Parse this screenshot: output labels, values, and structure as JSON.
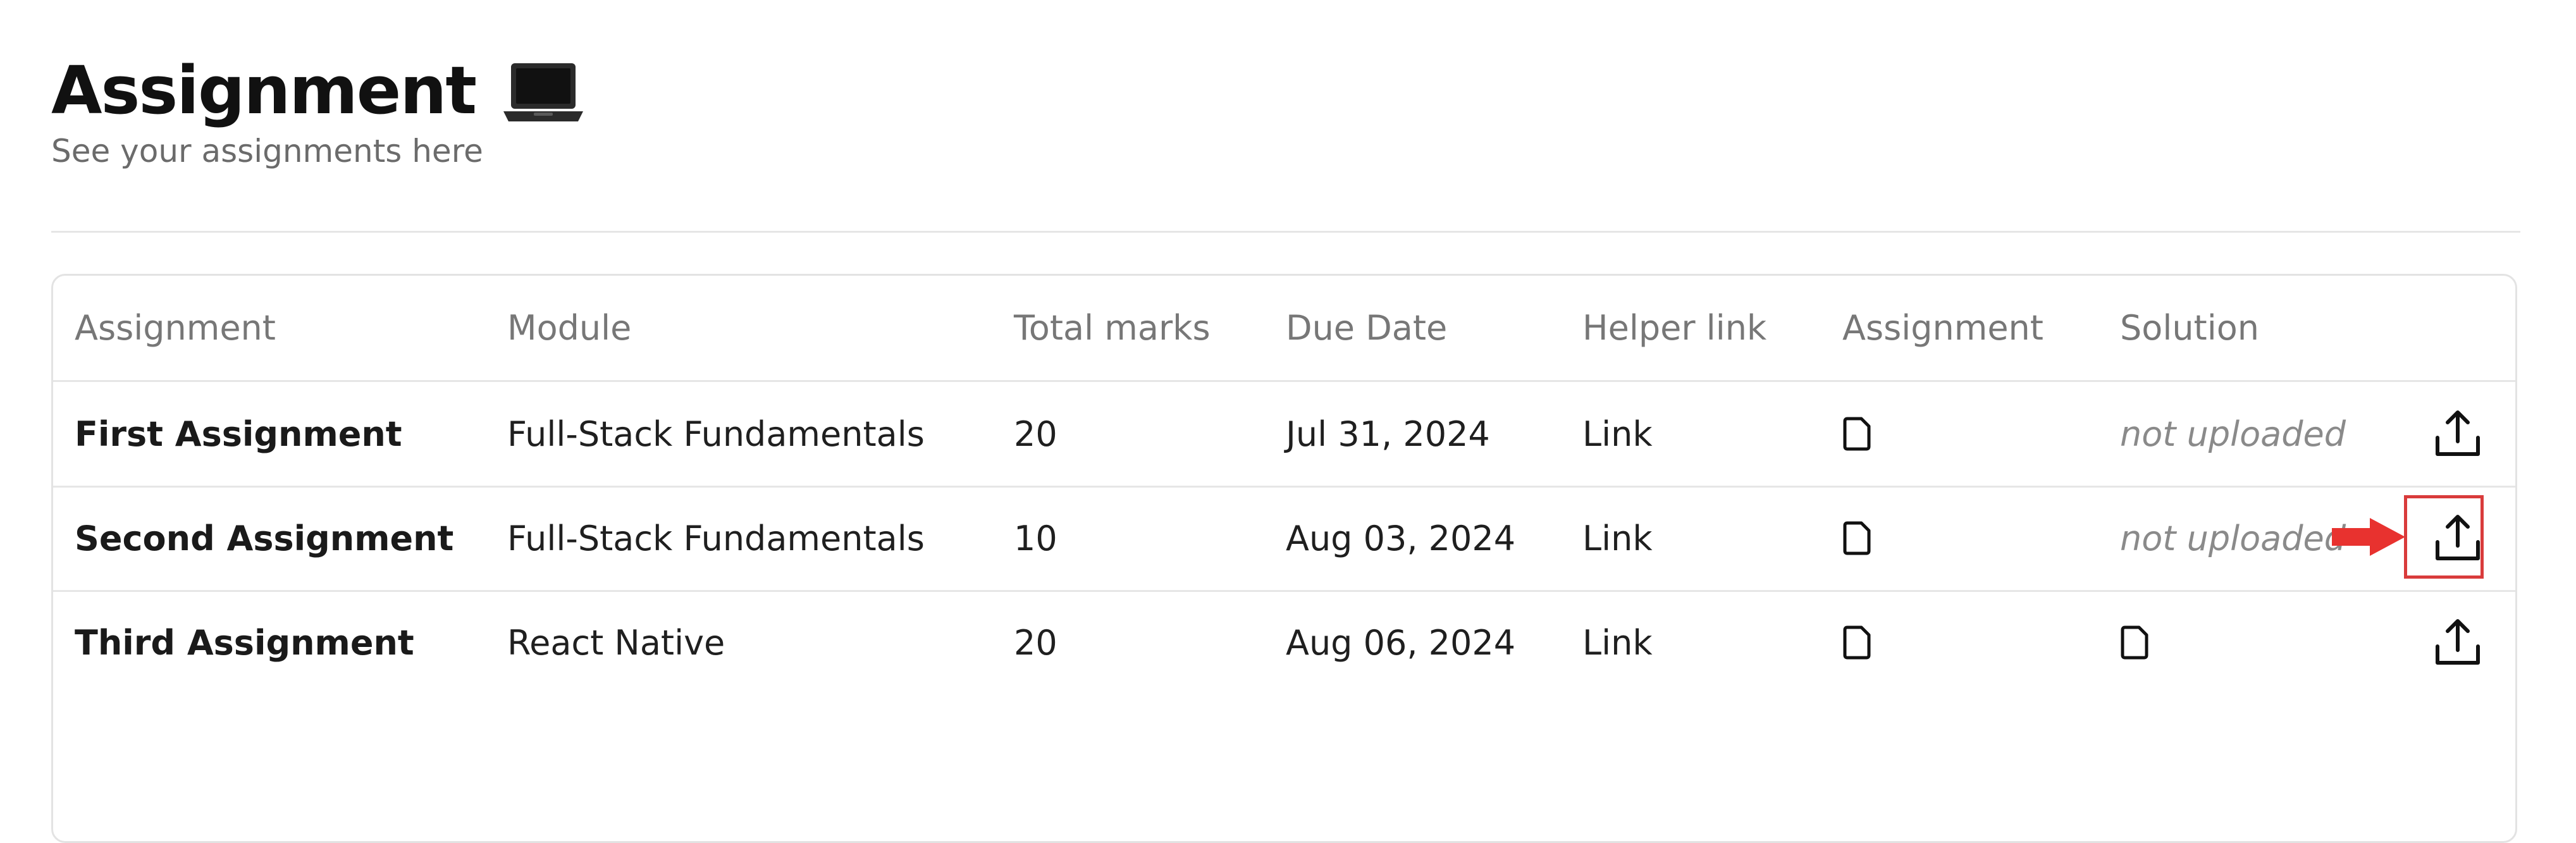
{
  "header": {
    "title": "Assignment",
    "title_icon": "laptop-icon",
    "subtitle": "See your assignments here"
  },
  "table": {
    "columns": [
      "Assignment",
      "Module",
      "Total marks",
      "Due Date",
      "Helper link",
      "Assignment",
      "Solution"
    ],
    "rows": [
      {
        "assignment": "First Assignment",
        "module": "Full-Stack Fundamentals",
        "total_marks": "20",
        "due_date": "Jul 31, 2024",
        "helper_link": "Link",
        "assignment_file_icon": "document-icon",
        "solution": "not uploaded",
        "upload_icon": "upload-icon"
      },
      {
        "assignment": "Second Assignment",
        "module": "Full-Stack Fundamentals",
        "total_marks": "10",
        "due_date": "Aug 03, 2024",
        "helper_link": "Link",
        "assignment_file_icon": "document-icon",
        "solution": "not uploaded",
        "upload_icon": "upload-icon"
      },
      {
        "assignment": "Third Assignment",
        "module": "React Native",
        "total_marks": "20",
        "due_date": "Aug 06, 2024",
        "helper_link": "Link",
        "assignment_file_icon": "document-icon",
        "solution_icon": "document-icon",
        "upload_icon": "upload-icon"
      }
    ]
  },
  "annotation": {
    "highlight_color": "#d93b3b",
    "arrow_icon": "red-arrow-icon",
    "target": "second-row-upload-button"
  }
}
